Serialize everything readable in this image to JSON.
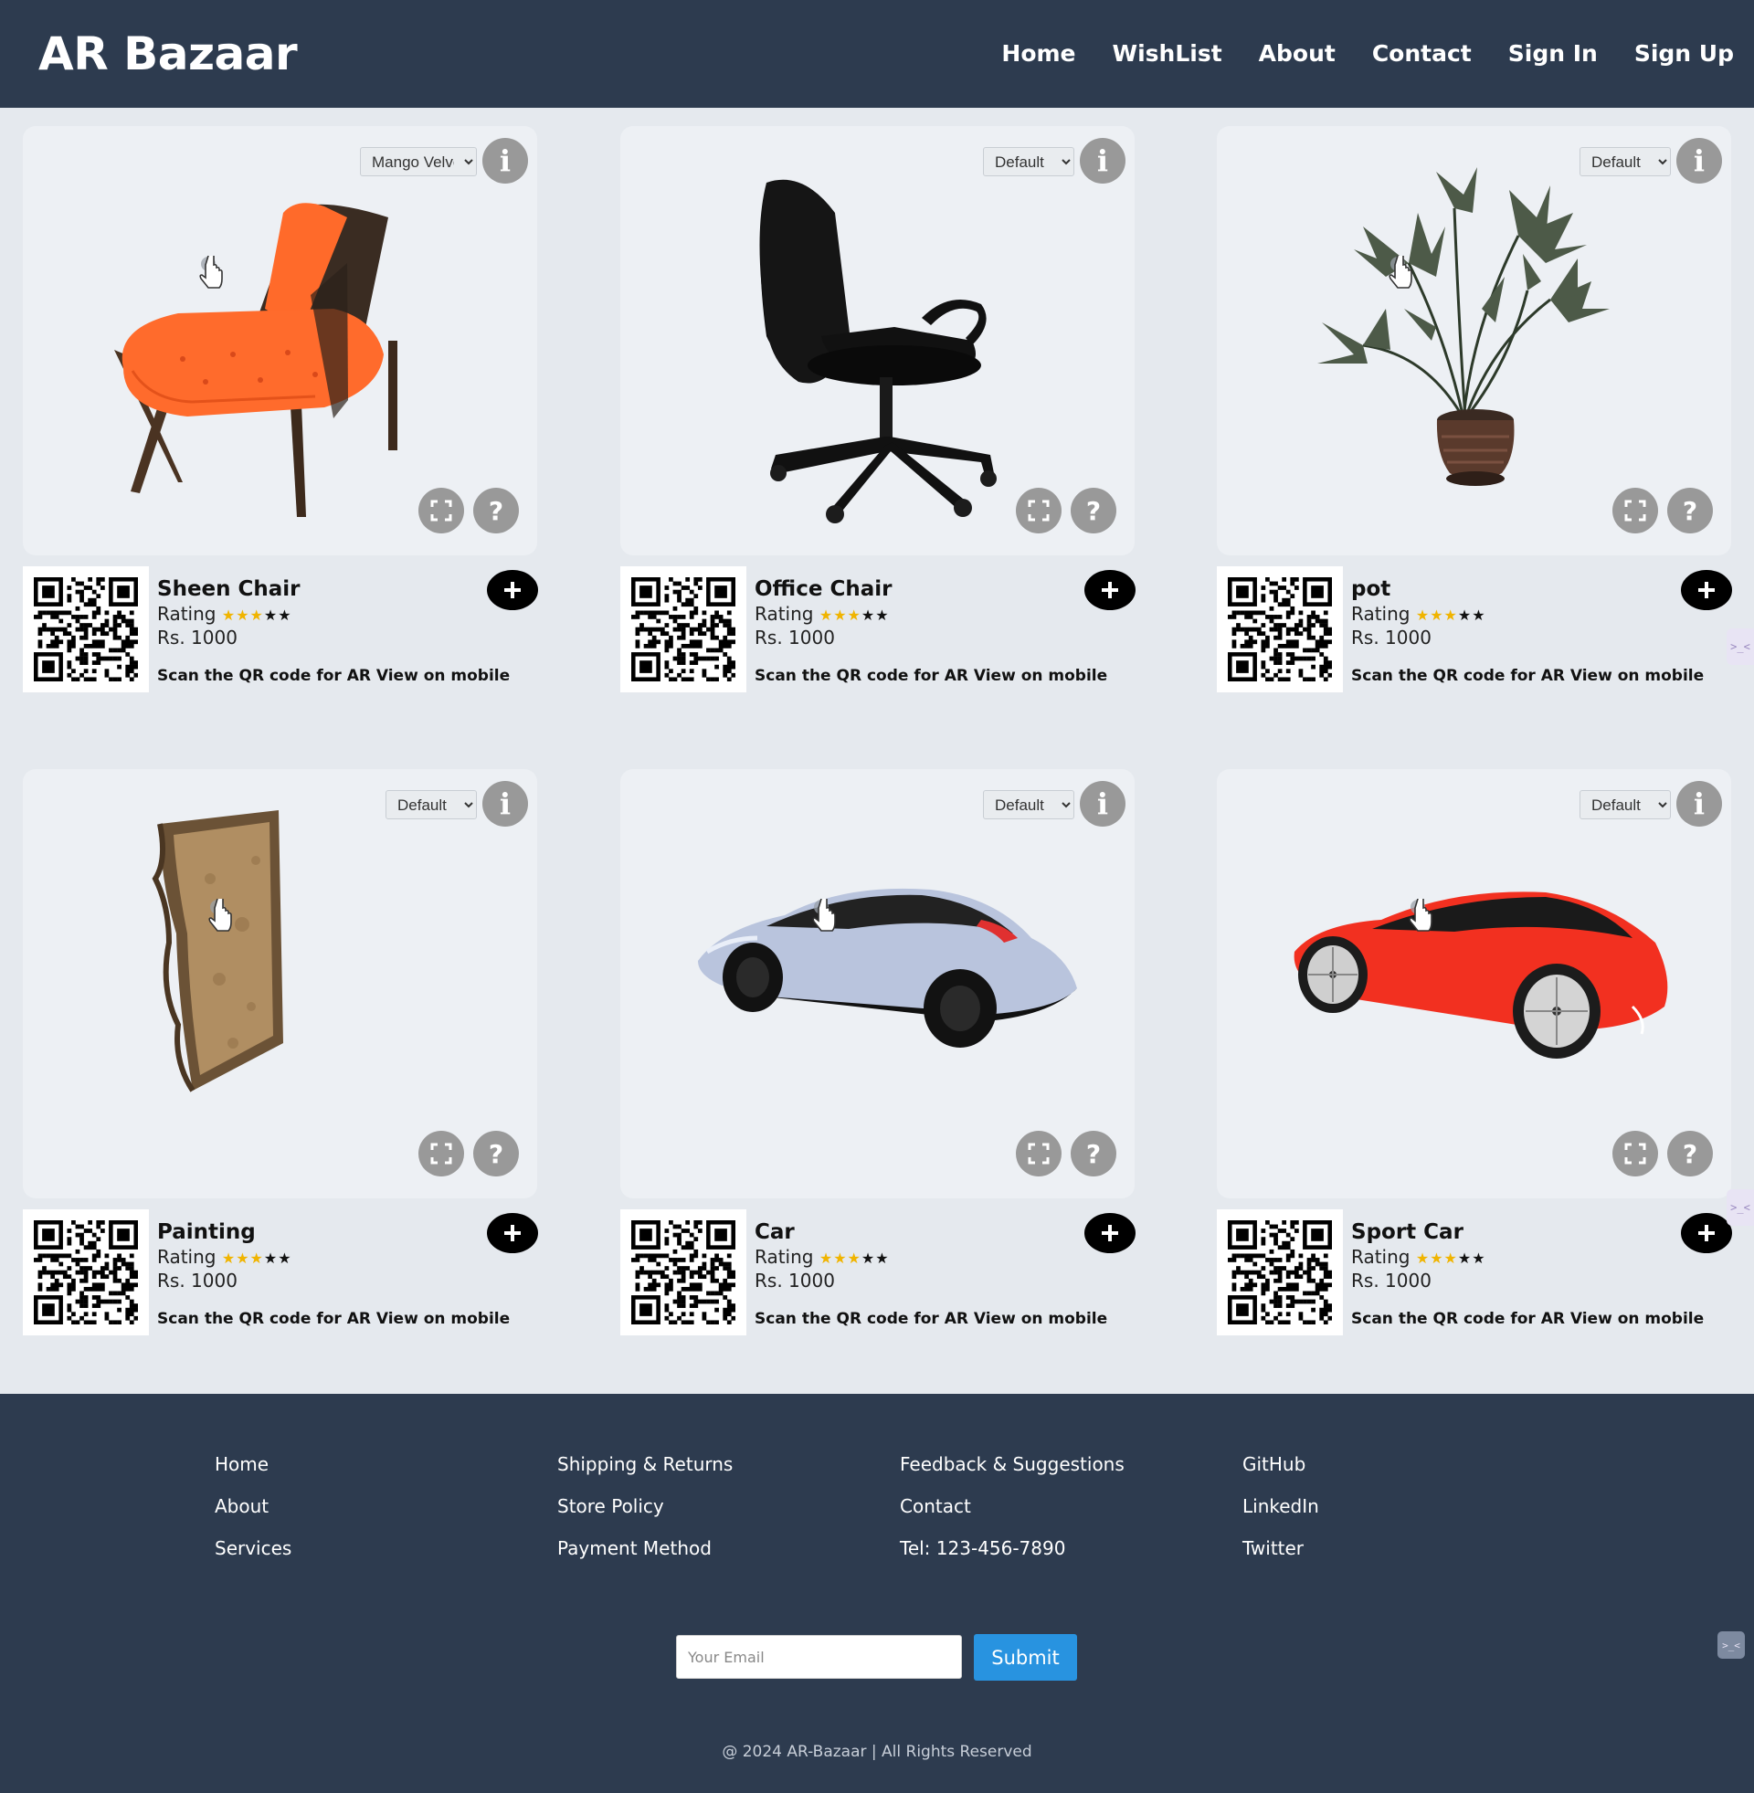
{
  "nav": {
    "brand": "AR Bazaar",
    "links": [
      "Home",
      "WishList",
      "About",
      "Contact",
      "Sign In",
      "Sign Up"
    ]
  },
  "products": [
    {
      "name": "Sheen Chair",
      "variant": "Mango Velvet",
      "rating_label": "Rating",
      "stars_filled": 3,
      "stars_total": 5,
      "price": "Rs. 1000",
      "scan_text": "Scan the QR code for AR View on mobile",
      "model": "orange-velvet-chair"
    },
    {
      "name": "Office Chair",
      "variant": "Default",
      "rating_label": "Rating",
      "stars_filled": 3,
      "stars_total": 5,
      "price": "Rs. 1000",
      "scan_text": "Scan the QR code for AR View on mobile",
      "model": "black-office-chair"
    },
    {
      "name": "pot",
      "variant": "Default",
      "rating_label": "Rating",
      "stars_filled": 3,
      "stars_total": 5,
      "price": "Rs. 1000",
      "scan_text": "Scan the QR code for AR View on mobile",
      "model": "potted-plant"
    },
    {
      "name": "Painting",
      "variant": "Default",
      "rating_label": "Rating",
      "stars_filled": 3,
      "stars_total": 5,
      "price": "Rs. 1000",
      "scan_text": "Scan the QR code for AR View on mobile",
      "model": "framed-painting"
    },
    {
      "name": "Car",
      "variant": "Default",
      "rating_label": "Rating",
      "stars_filled": 3,
      "stars_total": 5,
      "price": "Rs. 1000",
      "scan_text": "Scan the QR code for AR View on mobile",
      "model": "silver-concept-car"
    },
    {
      "name": "Sport Car",
      "variant": "Default",
      "rating_label": "Rating",
      "stars_filled": 3,
      "stars_total": 5,
      "price": "Rs. 1000",
      "scan_text": "Scan the QR code for AR View on mobile",
      "model": "red-sport-car"
    }
  ],
  "viewer_buttons": {
    "info": "i",
    "help": "?"
  },
  "footer": {
    "columns": [
      [
        "Home",
        "About",
        "Services"
      ],
      [
        "Shipping & Returns",
        "Store Policy",
        "Payment Method"
      ],
      [
        "Feedback & Suggestions",
        "Contact",
        "Tel: 123-456-7890"
      ],
      [
        "GitHub",
        "LinkedIn",
        "Twitter"
      ]
    ],
    "email_placeholder": "Your Email",
    "submit_label": "Submit",
    "copyright": "@ 2024 AR-Bazaar | All Rights Reserved"
  },
  "colors": {
    "nav_bg": "#2d3b4f",
    "page_bg": "#e5e9ee",
    "card_bg": "#edf0f4",
    "star_gold": "#f0b400",
    "submit_blue": "#2893e0"
  }
}
